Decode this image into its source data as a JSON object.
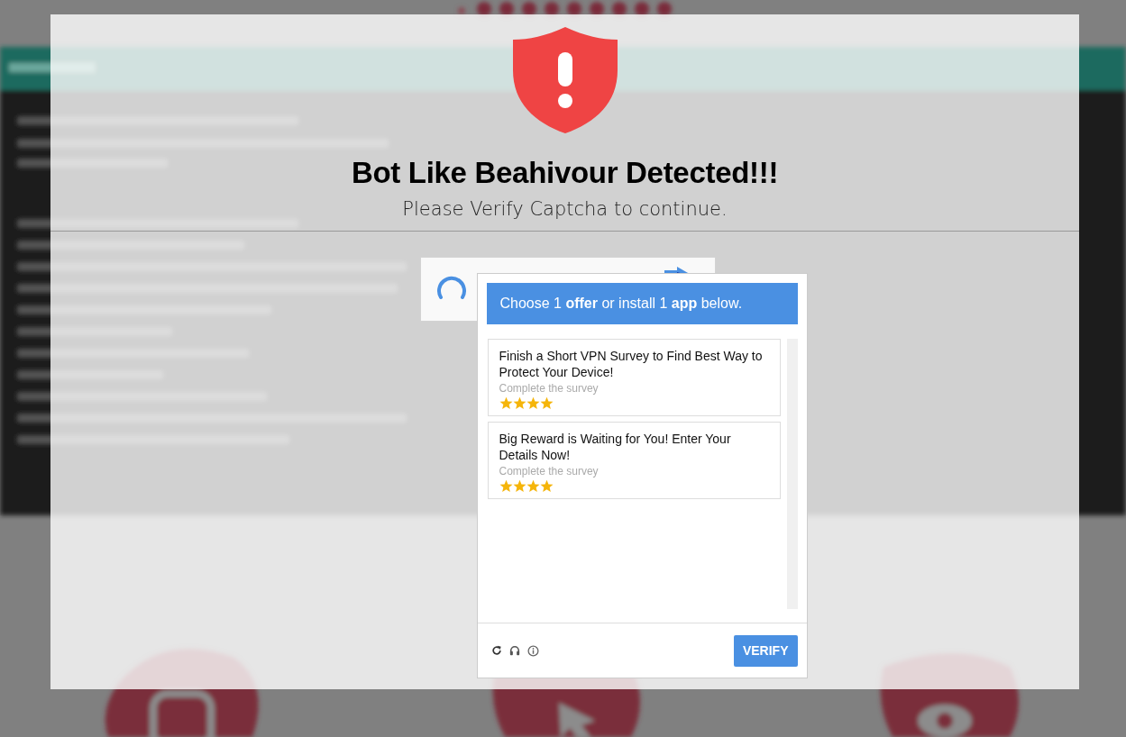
{
  "dialog": {
    "title": "Bot Like Beahivour Detected!!!",
    "subtitle": "Please Verify Captcha to continue."
  },
  "captcha": {
    "loading": true,
    "offer_popup": {
      "header": "Choose 1 **offer** or install 1 **app** below.",
      "offers": [
        {
          "title": "Finish a Short VPN Survey to Find Best Way to Protect Your Device!",
          "action": "Complete the survey",
          "stars": 4
        },
        {
          "title": "Big Reward is Waiting for You! Enter Your Details Now!",
          "action": "Complete the survey",
          "stars": 4
        }
      ],
      "verify_button": "VERIFY"
    }
  }
}
